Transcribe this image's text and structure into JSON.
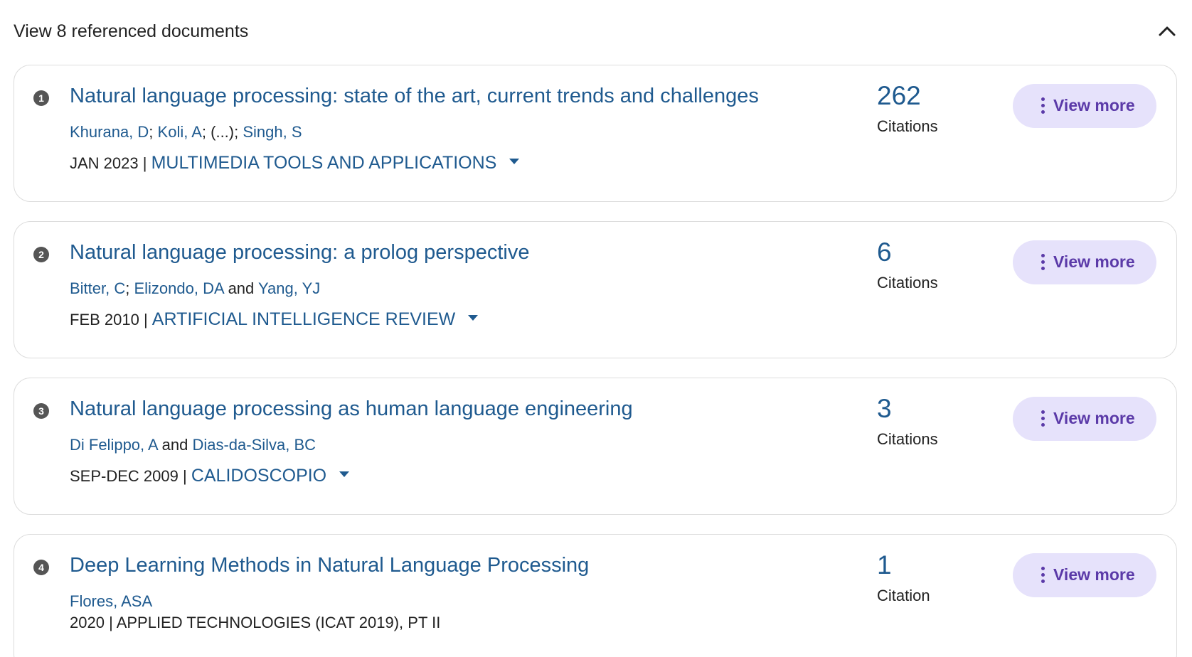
{
  "header": {
    "title": "View 8 referenced documents"
  },
  "documents": [
    {
      "number": "1",
      "title": "Natural language processing: state of the art, current trends and challenges",
      "authors": [
        {
          "text": "Khurana, D",
          "link": true
        },
        {
          "text": "; ",
          "link": false
        },
        {
          "text": "Koli, A",
          "link": true
        },
        {
          "text": "; (...); ",
          "link": false
        },
        {
          "text": "Singh, S",
          "link": true
        }
      ],
      "date": "JAN 2023",
      "separator": " | ",
      "journal": "MULTIMEDIA TOOLS AND APPLICATIONS",
      "citations": "262",
      "citations_label": "Citations",
      "view_more_label": "View more"
    },
    {
      "number": "2",
      "title": "Natural language processing: a prolog perspective",
      "authors": [
        {
          "text": "Bitter, C",
          "link": true
        },
        {
          "text": "; ",
          "link": false
        },
        {
          "text": "Elizondo, DA",
          "link": true
        },
        {
          "text": " and ",
          "link": false
        },
        {
          "text": "Yang, YJ",
          "link": true
        }
      ],
      "date": "FEB 2010",
      "separator": " | ",
      "journal": "ARTIFICIAL INTELLIGENCE REVIEW",
      "citations": "6",
      "citations_label": "Citations",
      "view_more_label": "View more"
    },
    {
      "number": "3",
      "title": "Natural language processing as human language engineering",
      "authors": [
        {
          "text": "Di Felippo, A",
          "link": true
        },
        {
          "text": " and ",
          "link": false
        },
        {
          "text": "Dias-da-Silva, BC",
          "link": true
        }
      ],
      "date": "SEP-DEC 2009",
      "separator": " | ",
      "journal": "CALIDOSCOPIO",
      "citations": "3",
      "citations_label": "Citations",
      "view_more_label": "View more"
    },
    {
      "number": "4",
      "title": "Deep Learning Methods in Natural Language Processing",
      "authors": [
        {
          "text": "Flores, ASA",
          "link": true
        }
      ],
      "date": "2020",
      "separator": " | ",
      "journal": "APPLIED TECHNOLOGIES (ICAT 2019), PT II",
      "citations": "1",
      "citations_label": "Citation",
      "view_more_label": "View more"
    }
  ],
  "icons": {
    "collapse": "chevron-up-icon",
    "more": "vertical-dots-icon",
    "dropdown": "caret-down-icon"
  },
  "colors": {
    "link": "#1f5a8f",
    "button_bg": "#e6e2fb",
    "button_text": "#5b3aa8",
    "badge": "#555555",
    "card_border": "#dcdcdc"
  }
}
